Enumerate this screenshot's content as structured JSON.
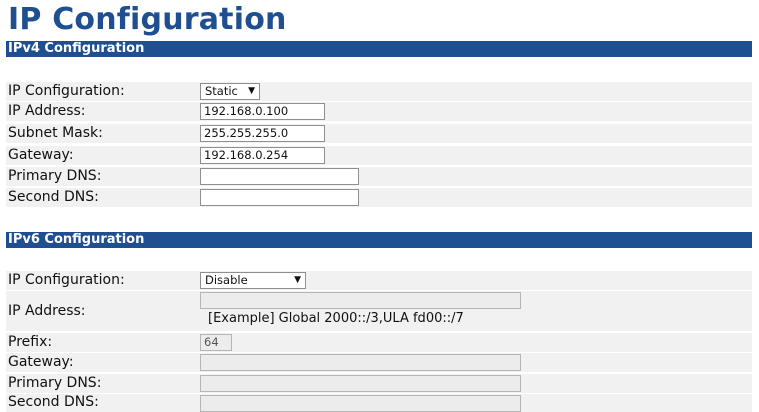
{
  "page": {
    "title": "IP Configuration"
  },
  "ipv4": {
    "section_title": "IPv4 Configuration",
    "config_label": "IP Configuration:",
    "config_value": "Static",
    "ip_label": "IP Address:",
    "ip_value": "192.168.0.100",
    "mask_label": "Subnet Mask:",
    "mask_value": "255.255.255.0",
    "gateway_label": "Gateway:",
    "gateway_value": "192.168.0.254",
    "dns1_label": "Primary DNS:",
    "dns1_value": "",
    "dns2_label": "Second DNS:",
    "dns2_value": ""
  },
  "ipv6": {
    "section_title": "IPv6 Configuration",
    "config_label": "IP Configuration:",
    "config_value": "Disable",
    "ip_label": "IP Address:",
    "ip_value": "",
    "ip_example": "[Example] Global 2000::/3,ULA fd00::/7",
    "prefix_label": "Prefix:",
    "prefix_value": "64",
    "gateway_label": "Gateway:",
    "gateway_value": "",
    "dns1_label": "Primary DNS:",
    "dns1_value": "",
    "dns2_label": "Second DNS:",
    "dns2_value": ""
  },
  "icons": {
    "dropdown": "triangle-down"
  },
  "colors": {
    "accent": "#1f4f90",
    "row_bg": "#f1f1f1",
    "disabled_bg": "#ececec"
  }
}
